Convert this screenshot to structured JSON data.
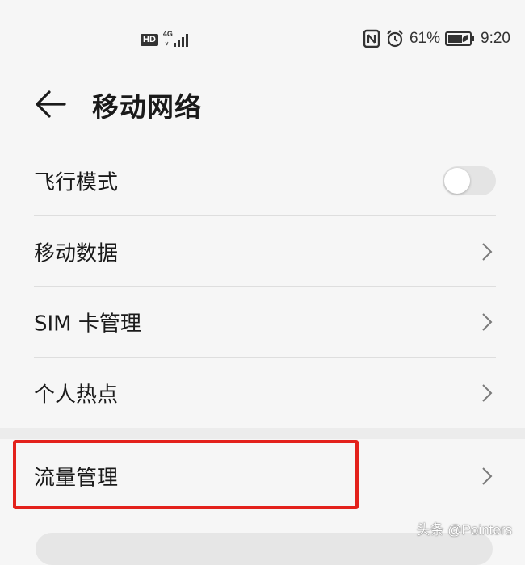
{
  "status_bar": {
    "hd_label": "HD",
    "network_label": "4G",
    "battery_percent_text": "61%",
    "time": "9:20",
    "icons": [
      "hd-icon",
      "signal-icon",
      "nfc-icon",
      "alarm-icon",
      "battery-icon"
    ]
  },
  "header": {
    "title": "移动网络",
    "back_icon": "arrow-left-icon"
  },
  "settings": {
    "items": [
      {
        "label": "飞行模式",
        "type": "toggle",
        "toggle_on": false
      },
      {
        "label": "移动数据",
        "type": "link"
      },
      {
        "label": "SIM 卡管理",
        "type": "link"
      },
      {
        "label": "个人热点",
        "type": "link"
      }
    ]
  },
  "traffic": {
    "label": "流量管理",
    "highlight_color": "#e3211b"
  },
  "watermark": "头条 @Pointers",
  "colors": {
    "background": "#f6f6f6",
    "divider": "#dedede",
    "toggle_off": "#e4e4e4",
    "text": "#1a1a1a"
  }
}
